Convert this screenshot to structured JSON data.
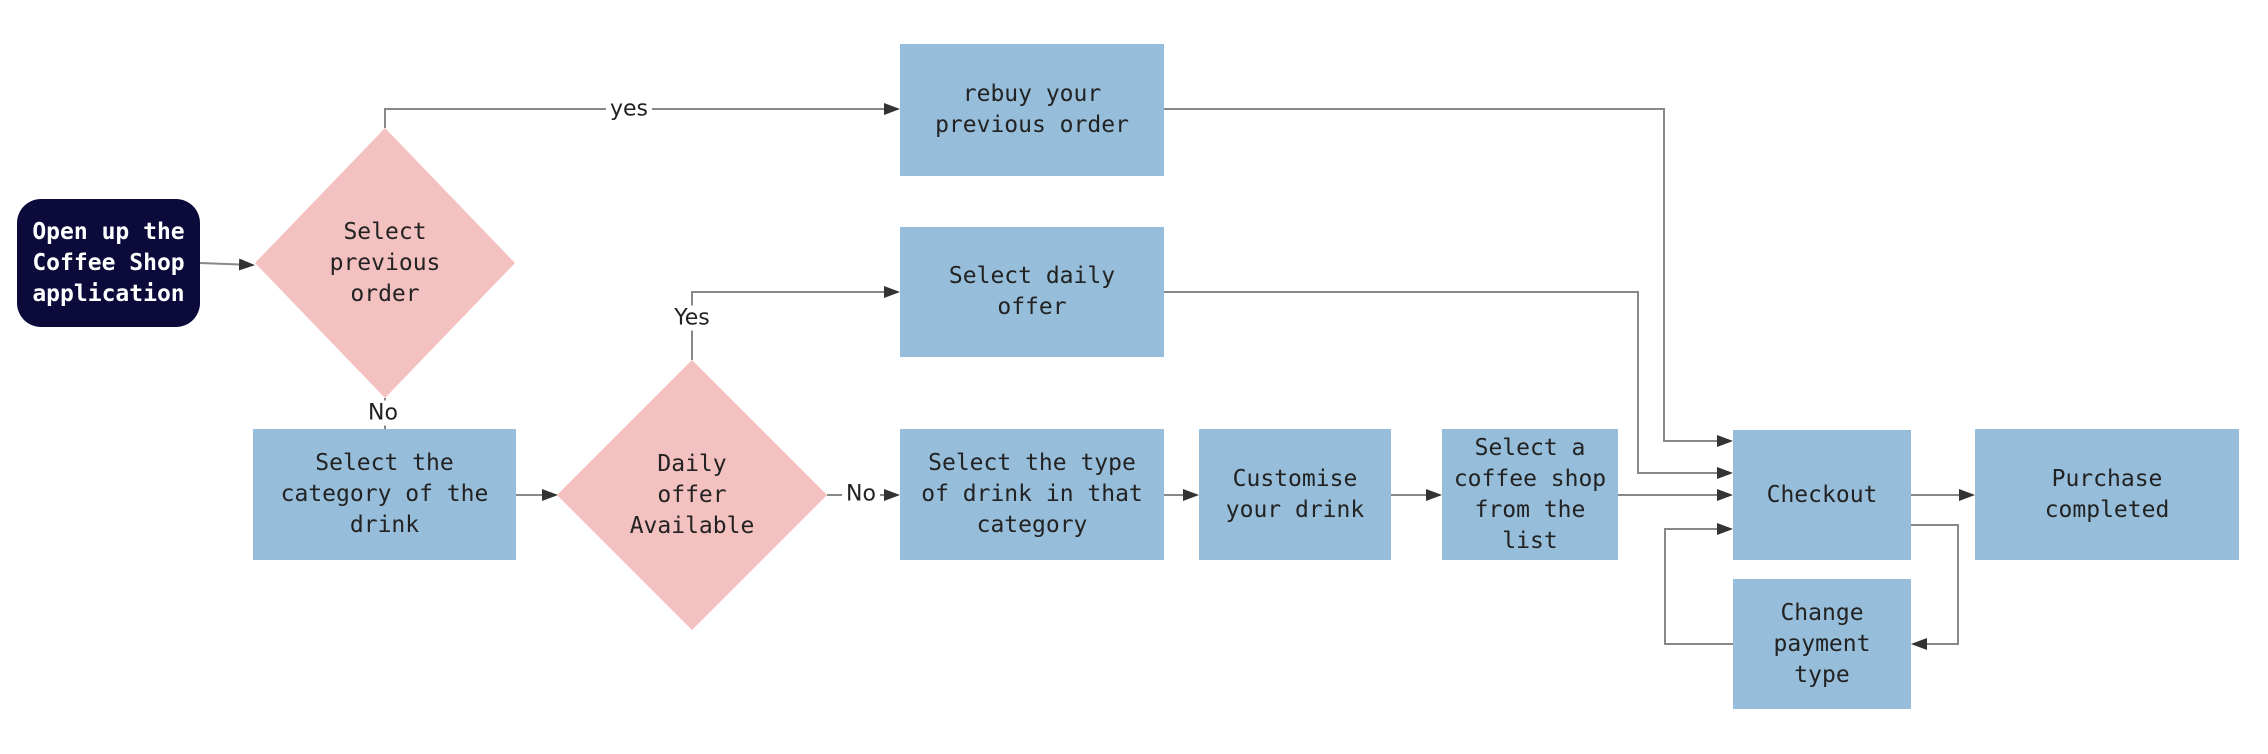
{
  "colors": {
    "process": "#96bdd9",
    "decision": "#f4c1c1",
    "start": "#0b0a3a",
    "edge": "#777777"
  },
  "nodes": {
    "start": "Open up the\nCoffee Shop\napplication",
    "select_previous": "Select\nprevious\norder",
    "rebuy": "rebuy your\nprevious order",
    "daily_offer_select": "Select daily\noffer",
    "category": "Select the\ncategory of the\ndrink",
    "daily_offer_available": "Daily\noffer\nAvailable",
    "drink_type": "Select the type\nof drink in that\ncategory",
    "customise": "Customise\nyour drink",
    "shop": "Select a\ncoffee shop\nfrom the\nlist",
    "checkout": "Checkout",
    "purchase": "Purchase\ncompleted",
    "change_payment": "Change\npayment\ntype"
  },
  "edge_labels": {
    "yes1": "yes",
    "no1": "No",
    "yes2": "Yes",
    "no2": "No"
  }
}
